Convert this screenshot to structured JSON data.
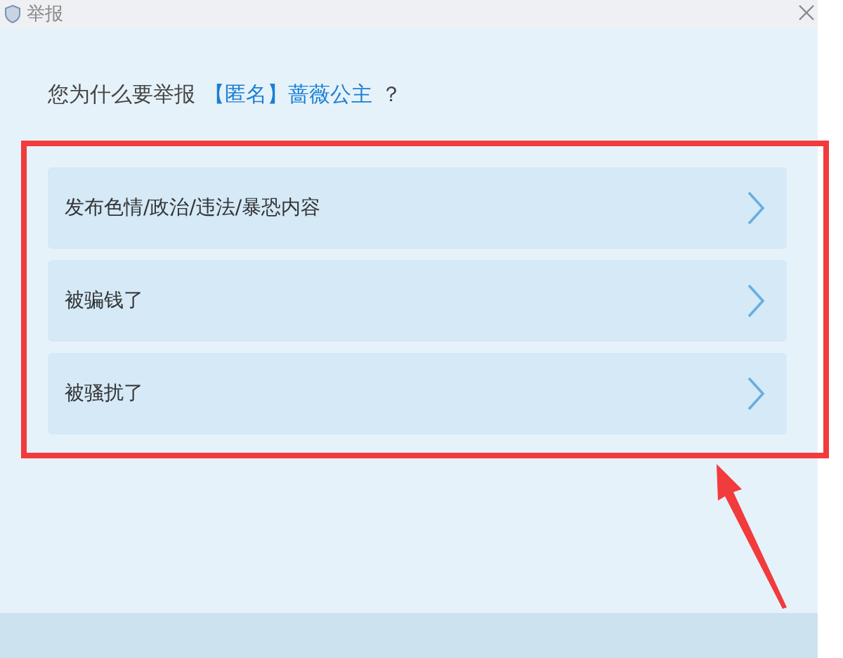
{
  "window": {
    "title": "举报"
  },
  "question": {
    "text": "您为什么要举报",
    "target": "【匿名】蔷薇公主",
    "suffix": "？"
  },
  "options": [
    {
      "label": "发布色情/政治/违法/暴恐内容"
    },
    {
      "label": "被骗钱了"
    },
    {
      "label": "被骚扰了"
    }
  ]
}
